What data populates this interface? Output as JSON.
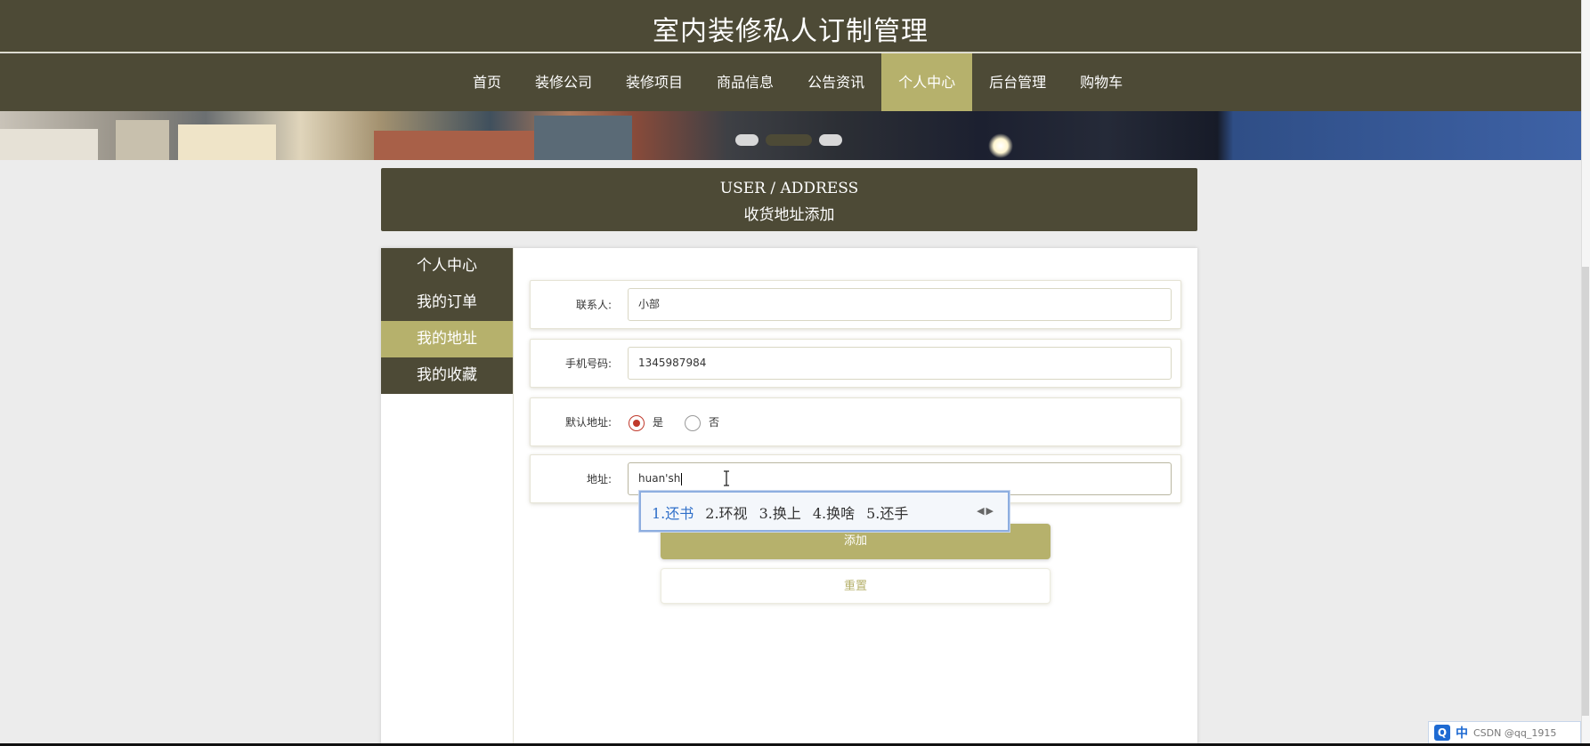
{
  "site": {
    "title": "室内装修私人订制管理"
  },
  "nav": {
    "items": [
      {
        "label": "首页",
        "active": false
      },
      {
        "label": "装修公司",
        "active": false
      },
      {
        "label": "装修项目",
        "active": false
      },
      {
        "label": "商品信息",
        "active": false
      },
      {
        "label": "公告资讯",
        "active": false
      },
      {
        "label": "个人中心",
        "active": true
      },
      {
        "label": "后台管理",
        "active": false
      },
      {
        "label": "购物车",
        "active": false
      }
    ]
  },
  "carousel": {
    "slide_count": 3,
    "active_index": 1
  },
  "page_header": {
    "en": "USER / ADDRESS",
    "cn": "收货地址添加"
  },
  "sidebar": {
    "items": [
      {
        "label": "个人中心",
        "active": false
      },
      {
        "label": "我的订单",
        "active": false
      },
      {
        "label": "我的地址",
        "active": true
      },
      {
        "label": "我的收藏",
        "active": false
      }
    ]
  },
  "form": {
    "contact": {
      "label": "联系人:",
      "value": "小部"
    },
    "phone": {
      "label": "手机号码:",
      "value": "1345987984"
    },
    "default_address": {
      "label": "默认地址:",
      "yes": "是",
      "no": "否",
      "selected": "是"
    },
    "address": {
      "label": "地址:",
      "value": "huan'sh"
    },
    "add_button": "添加",
    "reset_button": "重置"
  },
  "ime": {
    "candidates": [
      "1.还书",
      "2.环视",
      "3.换上",
      "4.换啥",
      "5.还手"
    ]
  },
  "taskbar": {
    "q_icon": "Q",
    "mode": "中",
    "watermark": "CSDN @qq_1915"
  },
  "colors": {
    "primary": "#4d4a36",
    "accent": "#b6b16c",
    "radio": "#c0392b"
  }
}
